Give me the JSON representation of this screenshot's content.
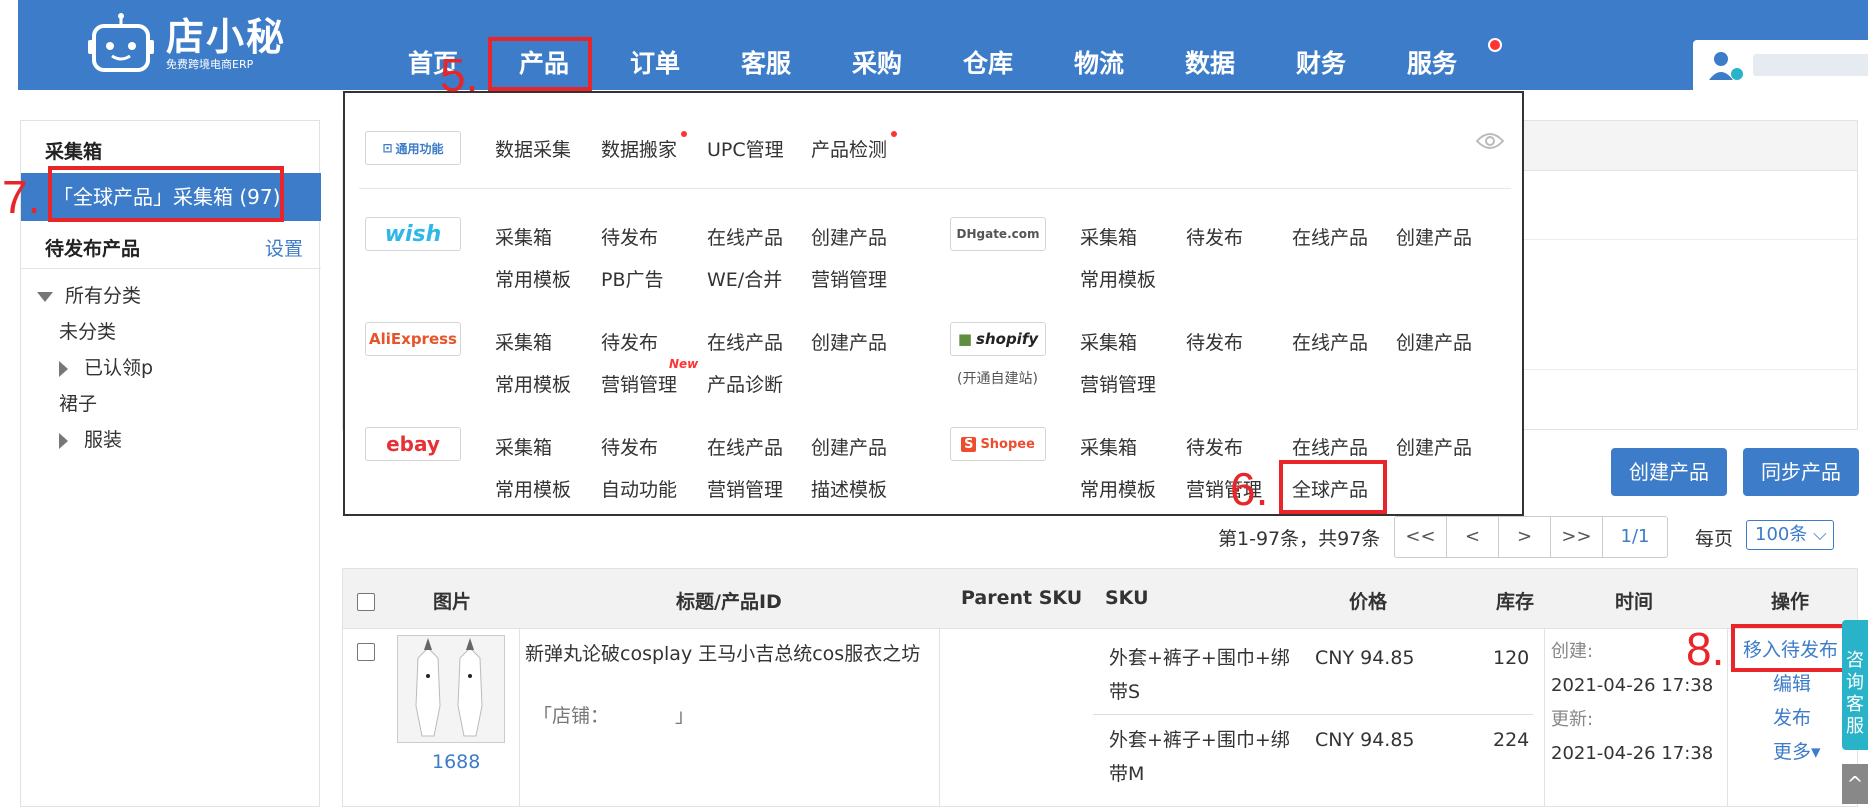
{
  "header": {
    "logo_name": "店小秘",
    "logo_sub": "免费跨境电商ERP",
    "nav": [
      "首页",
      "产品",
      "订单",
      "客服",
      "采购",
      "仓库",
      "物流",
      "数据",
      "财务",
      "服务"
    ]
  },
  "sidebar": {
    "collect_title": "采集箱",
    "selected_item": "「全球产品」采集箱 (97)",
    "pending_title": "待发布产品",
    "settings_link": "设置",
    "tree": [
      "所有分类",
      "未分类",
      "已认领p",
      "裙子",
      "服装"
    ]
  },
  "dropdown": {
    "general_badge": "通用功能",
    "general_items": [
      "数据采集",
      "数据搬家",
      "UPC管理",
      "产品检测"
    ],
    "platforms": {
      "wish": {
        "badge": "wish",
        "row1": [
          "采集箱",
          "待发布",
          "在线产品",
          "创建产品"
        ],
        "row2": [
          "常用模板",
          "PB广告",
          "WE/合并",
          "营销管理"
        ]
      },
      "dhgate": {
        "badge": "DHgate.com",
        "row1": [
          "采集箱",
          "待发布",
          "在线产品",
          "创建产品"
        ],
        "row2": [
          "常用模板"
        ]
      },
      "aliexpress": {
        "badge": "AliExpress",
        "row1": [
          "采集箱",
          "待发布",
          "在线产品",
          "创建产品"
        ],
        "row2": [
          "常用模板",
          "营销管理",
          "产品诊断"
        ],
        "new_tag": "New"
      },
      "shopify": {
        "badge": "shopify",
        "note": "(开通自建站)",
        "row1": [
          "采集箱",
          "待发布",
          "在线产品",
          "创建产品"
        ],
        "row2": [
          "营销管理"
        ]
      },
      "ebay": {
        "badge": "ebay",
        "row1": [
          "采集箱",
          "待发布",
          "在线产品",
          "创建产品"
        ],
        "row2": [
          "常用模板",
          "自动功能",
          "营销管理",
          "描述模板"
        ]
      },
      "shopee": {
        "badge": "Shopee",
        "row1": [
          "采集箱",
          "待发布",
          "在线产品",
          "创建产品"
        ],
        "row2": [
          "常用模板",
          "营销管理",
          "全球产品"
        ]
      }
    }
  },
  "toolbar": {
    "create_product": "创建产品",
    "sync_product": "同步产品"
  },
  "pagination": {
    "info": "第1-97条，共97条",
    "buttons": [
      "<<",
      "<",
      ">",
      ">>"
    ],
    "page": "1/1",
    "per_page_label": "每页",
    "per_page_value": "100条"
  },
  "table": {
    "headers": [
      "图片",
      "标题/产品ID",
      "Parent SKU",
      "SKU",
      "价格",
      "库存",
      "时间",
      "操作"
    ],
    "row": {
      "source": "1688",
      "title": "新弹丸论破cosplay 王马小吉总统cos服衣之坊",
      "shop": "「店铺：",
      "shop_end": "」",
      "variants": [
        {
          "sku_line1": "外套+裤子+围巾+绑",
          "sku_line2": "带S",
          "price": "CNY  94.85",
          "stock": "120"
        },
        {
          "sku_line1": "外套+裤子+围巾+绑",
          "sku_line2": "带M",
          "price": "CNY  94.85",
          "stock": "224"
        }
      ],
      "created_label": "创建:",
      "created": "2021-04-26 17:38",
      "updated_label": "更新:",
      "updated": "2021-04-26 17:38",
      "actions": [
        "移入待发布",
        "编辑",
        "发布",
        "更多▾"
      ]
    }
  },
  "annotations": [
    "5.",
    "6.",
    "7.",
    "8."
  ],
  "side_tab": "咨询客服",
  "scroll_top": "^",
  "colors": {
    "primary": "#3d7cc9",
    "annotation": "#e8262a",
    "service_tab": "#28b3c8"
  }
}
